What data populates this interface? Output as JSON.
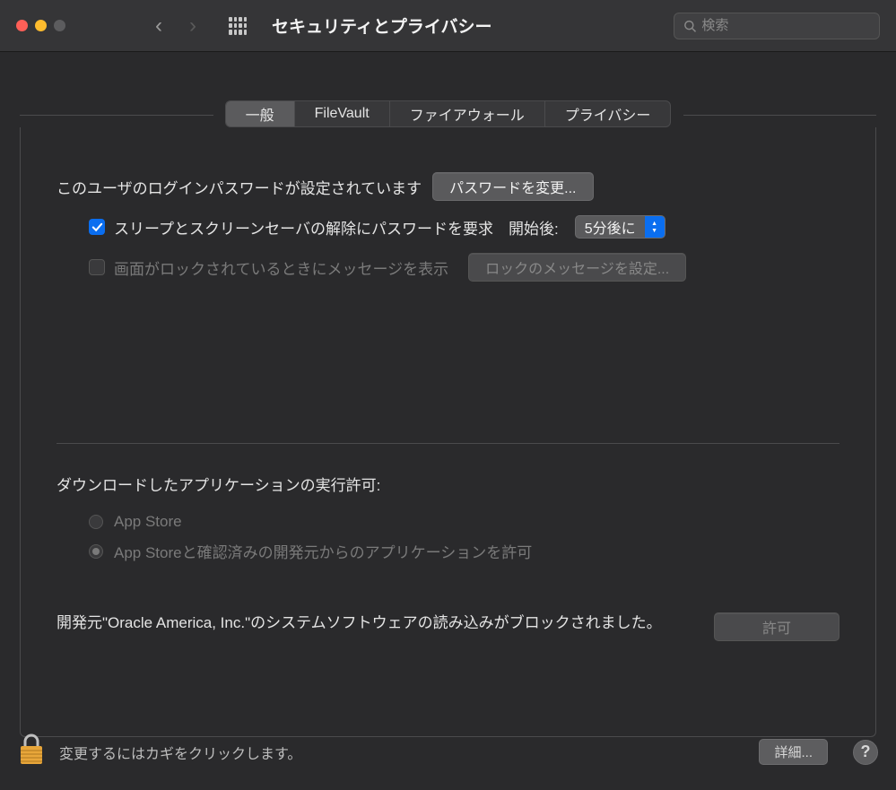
{
  "window": {
    "title": "セキュリティとプライバシー",
    "search_placeholder": "検索"
  },
  "tabs": [
    {
      "id": "general",
      "label": "一般",
      "active": true
    },
    {
      "id": "filevault",
      "label": "FileVault",
      "active": false
    },
    {
      "id": "firewall",
      "label": "ファイアウォール",
      "active": false
    },
    {
      "id": "privacy",
      "label": "プライバシー",
      "active": false
    }
  ],
  "general": {
    "password_set_text": "このユーザのログインパスワードが設定されています",
    "change_password_button": "パスワードを変更...",
    "require_password_checkbox": {
      "checked": true,
      "label": "スリープとスクリーンセーバの解除にパスワードを要求　開始後:"
    },
    "delay_select": "5分後に",
    "show_message_checkbox": {
      "checked": false,
      "label": "画面がロックされているときにメッセージを表示"
    },
    "set_lock_message_button": "ロックのメッセージを設定...",
    "download_section_title": "ダウンロードしたアプリケーションの実行許可:",
    "download_options": [
      {
        "label": "App Store",
        "selected": false
      },
      {
        "label": "App Storeと確認済みの開発元からのアプリケーションを許可",
        "selected": true
      }
    ],
    "blocked_software_text": "開発元\"Oracle America, Inc.\"のシステムソフトウェアの読み込みがブロックされました。",
    "allow_button": "許可"
  },
  "footer": {
    "lock_text": "変更するにはカギをクリックします。",
    "details_button": "詳細...",
    "help_label": "?"
  }
}
